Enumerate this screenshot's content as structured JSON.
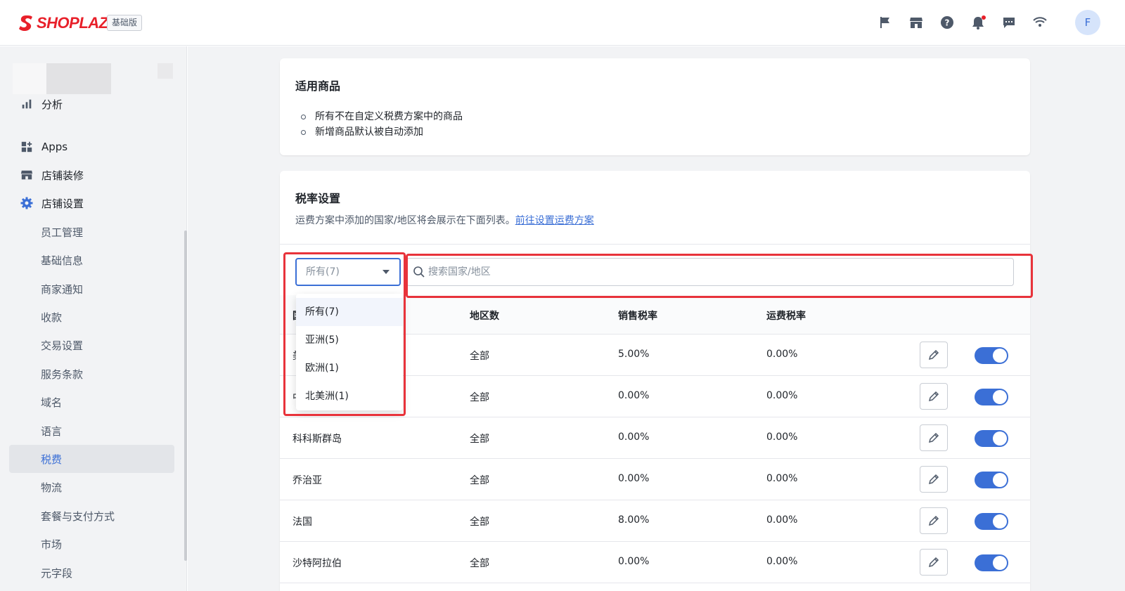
{
  "app": {
    "logo_text": "SHOPLAZZA",
    "plan_badge": "基础版",
    "avatar_initial": "F"
  },
  "topbar": {
    "icons": [
      "flag-icon",
      "store-icon",
      "help-icon",
      "bell-icon",
      "message-icon",
      "wifi-icon"
    ]
  },
  "sidebar": {
    "items": [
      {
        "label": "分析",
        "icon": "bar-chart-icon"
      },
      {
        "label": "Apps",
        "icon": "apps-grid-icon"
      },
      {
        "label": "店铺装修",
        "icon": "store-icon"
      },
      {
        "label": "店铺设置",
        "icon": "gear-icon"
      }
    ],
    "sub_items": [
      "员工管理",
      "基础信息",
      "商家通知",
      "收款",
      "交易设置",
      "服务条款",
      "域名",
      "语言",
      "税费",
      "物流",
      "套餐与支付方式",
      "市场",
      "元字段"
    ],
    "active_item": "税费"
  },
  "products_card": {
    "title": "适用商品",
    "bullets": [
      "所有不在自定义税费方案中的商品",
      "新增商品默认被自动添加"
    ]
  },
  "tax_card": {
    "title": "税率设置",
    "description": "运费方案中添加的国家/地区将会展示在下面列表。",
    "link": "前往设置运费方案",
    "filter": {
      "selected": "所有(7)",
      "options": [
        "所有(7)",
        "亚洲(5)",
        "欧洲(1)",
        "北美洲(1)"
      ]
    },
    "search_placeholder": "搜索国家/地区",
    "columns": {
      "country": "国",
      "regions": "地区数",
      "sales_tax": "销售税率",
      "shipping_tax": "运费税率"
    },
    "rows": [
      {
        "country": "美",
        "regions": "全部",
        "sales_tax": "5.00%",
        "shipping_tax": "0.00%",
        "enabled": true
      },
      {
        "country": "中",
        "regions": "全部",
        "sales_tax": "0.00%",
        "shipping_tax": "0.00%",
        "enabled": true
      },
      {
        "country": "科科斯群岛",
        "regions": "全部",
        "sales_tax": "0.00%",
        "shipping_tax": "0.00%",
        "enabled": true
      },
      {
        "country": "乔治亚",
        "regions": "全部",
        "sales_tax": "0.00%",
        "shipping_tax": "0.00%",
        "enabled": true
      },
      {
        "country": "法国",
        "regions": "全部",
        "sales_tax": "8.00%",
        "shipping_tax": "0.00%",
        "enabled": true
      },
      {
        "country": "沙特阿拉伯",
        "regions": "全部",
        "sales_tax": "0.00%",
        "shipping_tax": "0.00%",
        "enabled": true
      }
    ]
  },
  "colors": {
    "brand": "#e8202a",
    "accent": "#3b6fd6",
    "highlight": "#e8333b"
  }
}
